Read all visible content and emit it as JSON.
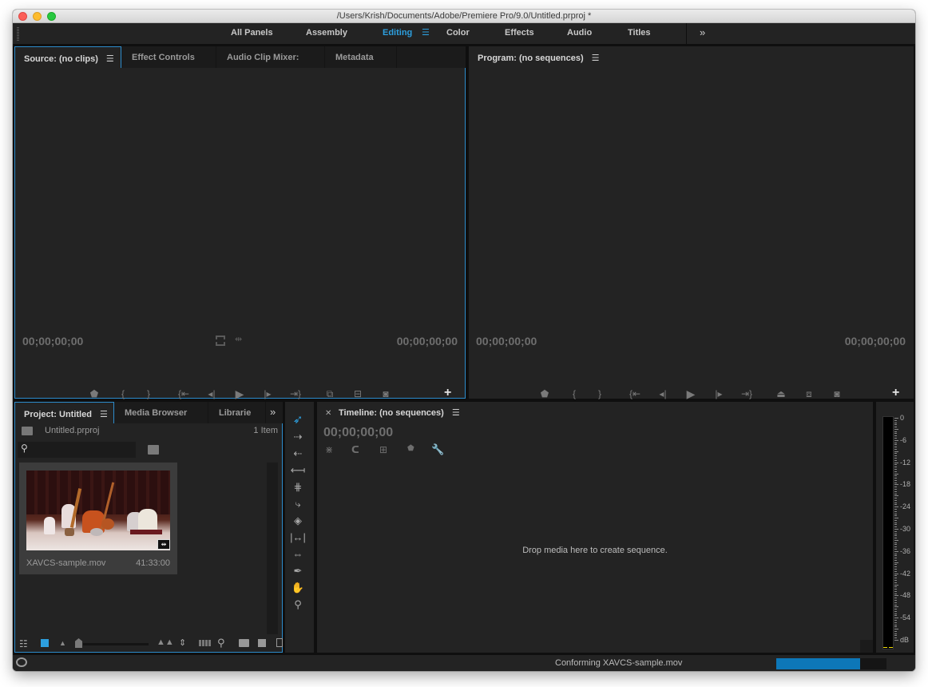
{
  "window": {
    "title": "/Users/Krish/Documents/Adobe/Premiere Pro/9.0/Untitled.prproj *"
  },
  "workspaces": {
    "items": [
      {
        "label": "All Panels",
        "active": false
      },
      {
        "label": "Assembly",
        "active": false
      },
      {
        "label": "Editing",
        "active": true
      },
      {
        "label": "Color",
        "active": false
      },
      {
        "label": "Effects",
        "active": false
      },
      {
        "label": "Audio",
        "active": false
      },
      {
        "label": "Titles",
        "active": false
      }
    ],
    "menu_glyph": "☰",
    "overflow_glyph": "»"
  },
  "source_panel": {
    "tabs": [
      {
        "label": "Source: (no clips)",
        "active": true
      },
      {
        "label": "Effect Controls",
        "active": false
      },
      {
        "label": "Audio Clip Mixer:",
        "active": false
      },
      {
        "label": "Metadata",
        "active": false
      }
    ],
    "timecode_left": "00;00;00;00",
    "timecode_right": "00;00;00;00",
    "controls": [
      "add-marker",
      "mark-in",
      "mark-out",
      "go-to-in",
      "step-back",
      "play",
      "step-forward",
      "go-to-out",
      "insert",
      "overwrite",
      "export-frame"
    ]
  },
  "program_panel": {
    "tabs": [
      {
        "label": "Program: (no sequences)",
        "active": true
      }
    ],
    "timecode_left": "00;00;00;00",
    "timecode_right": "00;00;00;00",
    "controls": [
      "add-marker",
      "mark-in",
      "mark-out",
      "go-to-in",
      "step-back",
      "play",
      "step-forward",
      "go-to-out",
      "lift",
      "extract",
      "export-frame"
    ]
  },
  "project_panel": {
    "tabs": [
      {
        "label": "Project: Untitled",
        "active": true
      },
      {
        "label": "Media Browser",
        "active": false
      },
      {
        "label": "Librarie",
        "active": false
      }
    ],
    "project_file": "Untitled.prproj",
    "item_count": "1 Item",
    "search": {
      "value": "",
      "placeholder": ""
    },
    "clips": [
      {
        "name": "XAVCS-sample.mov",
        "duration": "41:33:00"
      }
    ],
    "zoom_level": 0.0
  },
  "tools": [
    "selection",
    "track-select-forward",
    "track-select-backward",
    "ripple-edit",
    "rolling-edit",
    "rate-stretch",
    "razor",
    "slip",
    "slide",
    "pen",
    "hand",
    "zoom"
  ],
  "timeline_panel": {
    "title": "Timeline: (no sequences)",
    "timecode": "00;00;00;00",
    "drop_message": "Drop media here to create sequence."
  },
  "audio_meter": {
    "scale": [
      "0",
      "-6",
      "-12",
      "-18",
      "-24",
      "-30",
      "-36",
      "-42",
      "-48",
      "-54",
      "dB"
    ]
  },
  "status_bar": {
    "message": "Conforming XAVCS-sample.mov",
    "progress_percent": 76
  },
  "colors": {
    "accent": "#2d9fde",
    "focus_outline": "#2d8ccc",
    "progress": "#0d77b8",
    "panel_bg": "#232323",
    "meter_peak": "#f5e100"
  }
}
